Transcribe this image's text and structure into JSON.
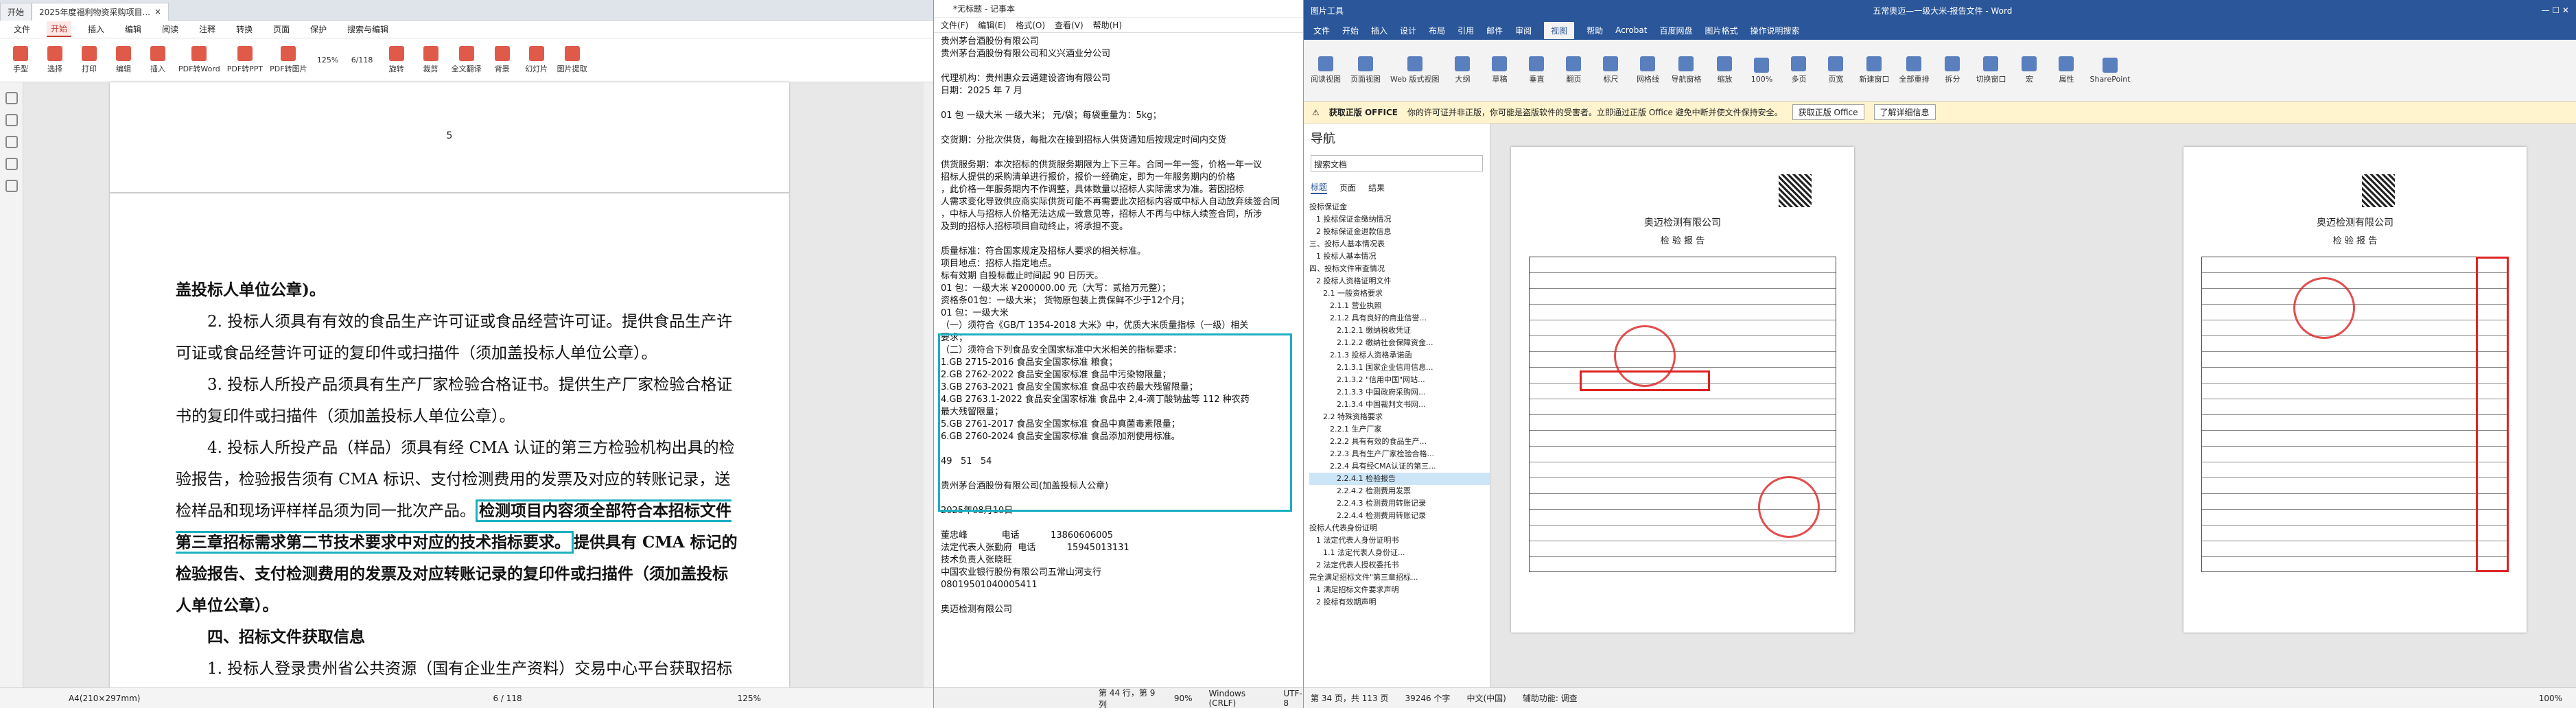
{
  "pdf": {
    "tabs": [
      "开始",
      "2025年度福利物资采购项目..."
    ],
    "menu": [
      "文件",
      "开始",
      "插入",
      "编辑",
      "阅读",
      "注释",
      "转换",
      "页面",
      "保护",
      "搜索与编辑"
    ],
    "menu_active": "开始",
    "ribbon": [
      "手型",
      "选择",
      "打印",
      "编辑",
      "插入",
      "PDF转Word",
      "PDF转PPT",
      "PDF转图片",
      "旋转",
      "裁剪",
      "全文翻译",
      "背景",
      "幻灯片",
      "图片提取"
    ],
    "zoom": "125%",
    "page_indicator": "6/118",
    "page_number_top": "5",
    "paragraphs": [
      "盖投标人单位公章)。",
      "2. 投标人须具有有效的食品生产许可证或食品经营许可证。提供食品生产许可证或食品经营许可证的复印件或扫描件（须加盖投标人单位公章）。",
      "3. 投标人所投产品须具有生产厂家检验合格证书。提供生产厂家检验合格证书的复印件或扫描件（须加盖投标人单位公章）。",
      "4. 投标人所投产品（样品）须具有经 CMA 认证的第三方检验机构出具的检验报告，检验报告须有 CMA 标识、支付检测费用的发票及对应的转账记录，送检样品和现场评样样品须为同一批次产品。",
      "检测项目内容须全部符合本招标文件第三章招标需求第二节技术要求中对应的技术指标要求。",
      "提供具有 CMA 标记的检验报告、支付检测费用的发票及对应转账记录的复印件或扫描件（须加盖投标人单位公章）。",
      "四、招标文件获取信息",
      "1. 投标人登录贵州省公共资源（国有企业生产资料）交易中心平台获取招标"
    ],
    "status_left": "A4(210×297mm)",
    "status_page": "6 / 118",
    "status_zoom": "125%"
  },
  "notepad": {
    "title": "*无标题 - 记事本",
    "menu": [
      "文件(F)",
      "编辑(E)",
      "格式(O)",
      "查看(V)",
      "帮助(H)"
    ],
    "lines": [
      "贵州茅台酒股份有限公司",
      "贵州茅台酒股份有限公司和义兴酒业分公司",
      "",
      "代理机构：贵州惠众云通建设咨询有限公司",
      "日期：2025 年 7 月",
      "",
      "01 包 一级大米 一级大米； 元/袋；每袋重量为：5kg；",
      "",
      "交货期：分批次供货，每批次在接到招标人供货通知后按规定时间内交货",
      "",
      "供货服务期：本次招标的供货服务期限为上下三年。合同一年一签，价格一年一议",
      "招标人提供的采购清单进行报价，报价一经确定，即为一年服务期内的价格",
      "，此价格一年服务期内不作调整，具体数量以招标人实际需求为准。若因招标",
      "人需求变化导致供应商实际供货可能不再需要此次招标内容或中标人自动放弃续签合同",
      "，中标人与招标人价格无法达成一致意见等，招标人不再与中标人续签合同，所涉",
      "及到的招标人招标项目自动终止，将承担不变。",
      "",
      "质量标准：符合国家规定及招标人要求的相关标准。",
      "项目地点：招标人指定地点。",
      "标有效期 自投标截止时间起 90 日历天。",
      "01 包：一级大米 ¥200000.00 元（大写：贰拾万元整）；",
      "资格条01包：一级大米； 货物原包装上贵保鲜不少于12个月；",
      "01 包：一级大米",
      "（一）须符合《GB/T 1354-2018 大米》中，优质大米质量指标（一级）相关",
      "要求；",
      "（二）须符合下列食品安全国家标准中大米相关的指标要求：",
      "1.GB 2715-2016 食品安全国家标准 粮食；",
      "2.GB 2762-2022 食品安全国家标准 食品中污染物限量；",
      "3.GB 2763-2021 食品安全国家标准 食品中农药最大残留限量；",
      "4.GB 2763.1-2022 食品安全国家标准 食品中 2,4-滴丁酸钠盐等 112 种农药",
      "最大残留限量；",
      "5.GB 2761-2017 食品安全国家标准 食品中真菌毒素限量；",
      "6.GB 2760-2024 食品安全国家标准 食品添加剂使用标准。",
      "",
      "49   51   54",
      "",
      "贵州茅台酒股份有限公司(加盖投标人公章)",
      "",
      "2025年08月10日",
      "",
      "董忠峰            电话           13860606005",
      "法定代表人张勤府  电话           15945013131",
      "技术负责人张晓旺",
      "中国农业银行股份有限公司五常山河支行",
      "08019501040005411",
      "",
      "奥迈检测有限公司"
    ],
    "status": [
      "第 44 行，第 9 列",
      "90%",
      "Windows (CRLF)",
      "UTF-8"
    ]
  },
  "word": {
    "title": "五常奥迈—一级大米-报告文件 - Word",
    "tool_title": "图片工具",
    "tabs": [
      "文件",
      "开始",
      "插入",
      "设计",
      "布局",
      "引用",
      "邮件",
      "审阅",
      "视图",
      "帮助",
      "Acrobat",
      "百度网盘",
      "图片格式",
      "操作说明搜索"
    ],
    "tab_active": "视图",
    "ribbon": [
      "阅读视图",
      "页面视图",
      "Web 版式视图",
      "大纲",
      "草稿",
      "垂直",
      "翻页",
      "标尺",
      "网格线",
      "导航窗格",
      "缩放",
      "100%",
      "多页",
      "页宽",
      "新建窗口",
      "全部重排",
      "拆分",
      "切换窗口",
      "宏",
      "属性",
      "SharePoint"
    ],
    "message_label": "获取正版 OFFICE",
    "message_text": "你的许可证并非正版，你可能是盗版软件的受害者。立即通过正版 Office 避免中断并使文件保持安全。",
    "message_btn1": "获取正版 Office",
    "message_btn2": "了解详细信息",
    "nav_title": "导航",
    "nav_search": "搜索文档",
    "nav_tabs": [
      "标题",
      "页面",
      "结果"
    ],
    "nav_items": [
      "投标保证金",
      "1 投标保证金缴纳情况",
      "2 投标保证金退款信息",
      "三、投标人基本情况表",
      "1 投标人基本情况",
      "四、投标文件审查情况",
      "2 投标人资格证明文件",
      "2.1 一般资格要求",
      "2.1.1 营业执照",
      "2.1.2 具有良好的商业信誉...",
      "2.1.2.1 缴纳税收凭证",
      "2.1.2.2 缴纳社会保障资金...",
      "2.1.3 投标人资格承诺函",
      "2.1.3.1 国家企业信用信息...",
      "2.1.3.2 \"信用中国\"网站...",
      "2.1.3.3 中国政府采购网...",
      "2.1.3.4 中国裁判文书网...",
      "2.2 特殊资格要求",
      "2.2.1 生产厂家",
      "2.2.2 具有有效的食品生产...",
      "2.2.3 具有生产厂家检验合格...",
      "2.2.4 具有经CMA认证的第三...",
      "2.2.4.1 检验报告",
      "2.2.4.2 检测费用发票",
      "2.2.4.3 检测费用转账记录",
      "2.2.4.4 检测费用转账记录",
      "投标人代表身份证明",
      "1 法定代表人身份证明书",
      "1.1 法定代表人身份证...",
      "2 法定代表人授权委托书",
      "完全满足招标文件\"第三章招标...",
      "1 满足招标文件要求声明",
      "2 投标有效期声明"
    ],
    "nav_selected": "2.2.4.1 检验报告",
    "page1_title": "奥迈检测有限公司",
    "page1_sub": "检 验 报 告",
    "page2_title": "奥迈检测有限公司",
    "page2_sub": "检 验 报 告",
    "status": [
      "第 34 页，共 113 页",
      "39246 个字",
      "中文(中国)",
      "辅助功能: 调查"
    ],
    "zoom_status": "100%"
  }
}
